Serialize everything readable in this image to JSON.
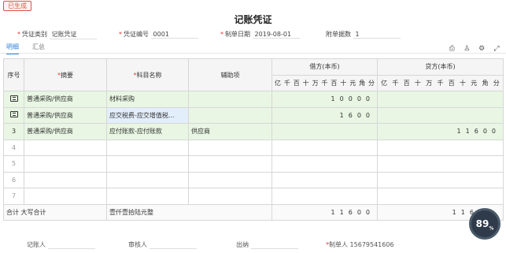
{
  "status_badge": "已生成",
  "title": "记账凭证",
  "meta": {
    "type_label": "凭证类别",
    "type_value": "记账凭证",
    "no_label": "凭证编号",
    "no_value": "0001",
    "date_label": "制单日期",
    "date_value": "2019-08-01",
    "attach_label": "附单据数",
    "attach_value": "1"
  },
  "tabs": [
    "明细",
    "汇总"
  ],
  "columns": {
    "seq": "序号",
    "summary": "摘要",
    "account": "科目名称",
    "aux": "辅助项",
    "debit": "借方(本币)",
    "credit": "贷方(本币)"
  },
  "digits": [
    "亿",
    "千",
    "百",
    "十",
    "万",
    "千",
    "百",
    "十",
    "元",
    "角",
    "分"
  ],
  "rows": [
    {
      "seq": "",
      "summary": "普通采购/供应商",
      "account": "材料采购",
      "aux": "",
      "debit": "10000",
      "credit": ""
    },
    {
      "seq": "",
      "summary": "普通采购/供应商",
      "account": "应交税费-应交增值税...",
      "aux": "",
      "debit": "1600",
      "credit": ""
    },
    {
      "seq": "3",
      "summary": "普通采购/供应商",
      "account": "应付账款-应付账款",
      "aux": "供应商",
      "debit": "",
      "credit": "11600"
    },
    {
      "seq": "4",
      "summary": "",
      "account": "",
      "aux": "",
      "debit": "",
      "credit": ""
    },
    {
      "seq": "5",
      "summary": "",
      "account": "",
      "aux": "",
      "debit": "",
      "credit": ""
    },
    {
      "seq": "6",
      "summary": "",
      "account": "",
      "aux": "",
      "debit": "",
      "credit": ""
    },
    {
      "seq": "7",
      "summary": "",
      "account": "",
      "aux": "",
      "debit": "",
      "credit": ""
    }
  ],
  "total": {
    "label": "合计 大写合计",
    "upper": "壹仟壹拾陆元整",
    "debit": "11600",
    "credit": "1160"
  },
  "footer": {
    "bookkeeper": "记账人",
    "auditor": "审核人",
    "cashier": "出纳",
    "maker": "制单人",
    "maker_value": "15679541606"
  },
  "progress_badge": "89"
}
